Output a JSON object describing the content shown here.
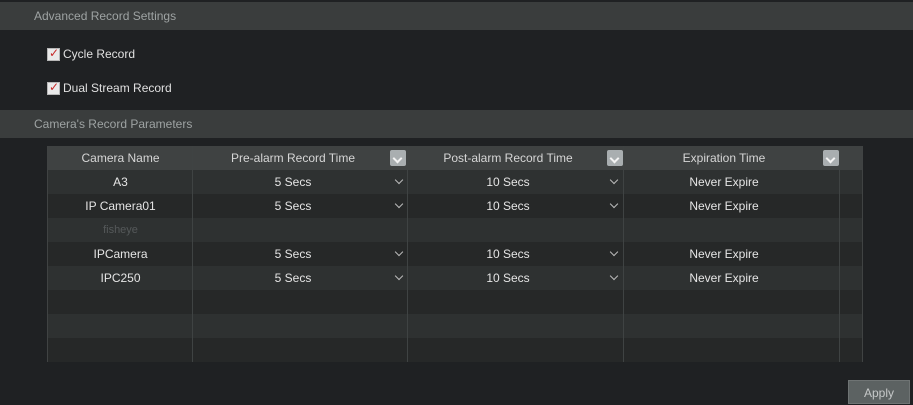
{
  "advanced_section": {
    "title": "Advanced Record Settings",
    "options": [
      {
        "label": "Cycle Record",
        "checked": true
      },
      {
        "label": "Dual Stream Record",
        "checked": true
      }
    ]
  },
  "camera_section": {
    "title": "Camera's Record Parameters"
  },
  "table": {
    "columns": [
      "Camera Name",
      "Pre-alarm Record Time",
      "Post-alarm Record Time",
      "Expiration Time"
    ],
    "rows": [
      {
        "name": "A3",
        "pre": "5 Secs",
        "post": "10 Secs",
        "expiration": "Never Expire",
        "enabled": true
      },
      {
        "name": "IP Camera01",
        "pre": "5 Secs",
        "post": "10 Secs",
        "expiration": "Never Expire",
        "enabled": true
      },
      {
        "name": "fisheye",
        "pre": "",
        "post": "",
        "expiration": "",
        "enabled": false
      },
      {
        "name": "IPCamera",
        "pre": "5 Secs",
        "post": "10 Secs",
        "expiration": "Never Expire",
        "enabled": true
      },
      {
        "name": "IPC250",
        "pre": "5 Secs",
        "post": "10 Secs",
        "expiration": "Never Expire",
        "enabled": true
      }
    ]
  },
  "buttons": {
    "apply": "Apply"
  },
  "colors": {
    "checkbox_tick": "#c62828",
    "header_bg": "#3a3d3d"
  }
}
